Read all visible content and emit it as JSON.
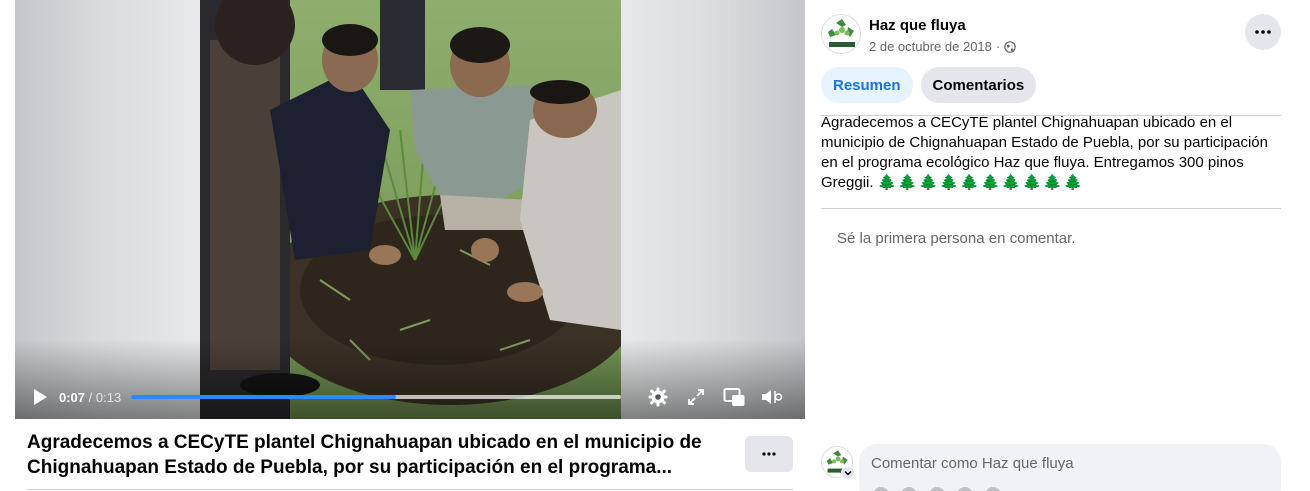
{
  "video": {
    "current_time": "0:07",
    "separator": " / ",
    "duration": "0:13",
    "progress_fraction": 0.54,
    "accent_color": "#2d88ff",
    "controls": [
      "play-icon",
      "settings-icon",
      "fullscreen-icon",
      "picture-in-picture-icon",
      "volume-icon"
    ]
  },
  "post": {
    "title": "Agradecemos a CECyTE plantel Chignahuapan ubicado en el municipio de Chignahuapan Estado de Puebla, por su participación en el programa...",
    "page_name": "Haz que fluya",
    "date": "2 de octubre de 2018",
    "meta_separator": " · ",
    "audience_icon": "globe-icon",
    "description": "Agradecemos a CECyTE plantel Chignahuapan ubicado en el municipio de Chignahuapan Estado de Puebla, por su participación en el programa ecológico Haz que fluya. Entregamos 300 pinos Greggii.",
    "description_emoji": "🌲🌲🌲🌲🌲🌲🌲🌲🌲🌲"
  },
  "tabs": [
    {
      "label": "Resumen",
      "active": true
    },
    {
      "label": "Comentarios",
      "active": false
    }
  ],
  "comments": {
    "empty_text": "Sé la primera persona en comentar.",
    "composer_placeholder": "Comentar como Haz que fluya"
  },
  "colors": {
    "accent": "#1b74e4",
    "tab_active_bg": "#e7f3ff",
    "secondary_text": "#65676b",
    "button_bg": "#e4e6eb"
  }
}
